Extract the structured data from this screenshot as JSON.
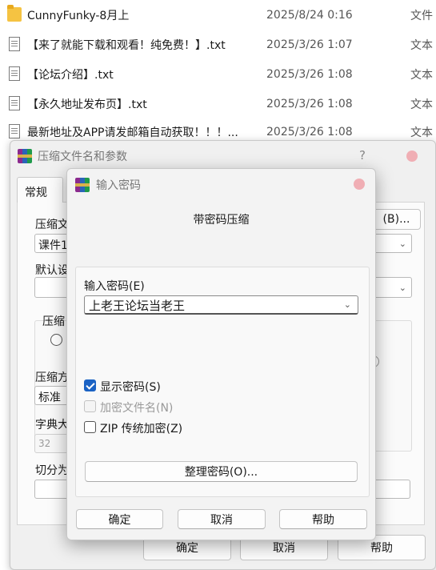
{
  "files": [
    {
      "name": "CunnyFunky-8月上",
      "date": "2025/8/24 0:16",
      "type": "文件",
      "icon": "folder-icon"
    },
    {
      "name": "【来了就能下载和观看！纯免费！】.txt",
      "date": "2025/3/26 1:07",
      "type": "文本",
      "icon": "text-file-icon"
    },
    {
      "name": "【论坛介绍】.txt",
      "date": "2025/3/26 1:08",
      "type": "文本",
      "icon": "text-file-icon"
    },
    {
      "name": "【永久地址发布页】.txt",
      "date": "2025/3/26 1:08",
      "type": "文本",
      "icon": "text-file-icon"
    },
    {
      "name": "最新地址及APP请发邮箱自动获取！！！...",
      "date": "2025/3/26 1:08",
      "type": "文本",
      "icon": "text-file-icon"
    }
  ],
  "main_dialog": {
    "title": "压缩文件名和参数",
    "help": "?",
    "tab_general": "常规",
    "archive_name_label": "压缩文",
    "archive_name_value": "课件1",
    "browse_button": "(B)...",
    "default_profile_label": "默认设",
    "format_label": "压缩",
    "method_label": "压缩方",
    "method_value": "标准",
    "dict_label": "字典大",
    "dict_value": "32",
    "split_label": "切分为",
    "ok": "确定",
    "cancel": "取消",
    "help_button": "帮助"
  },
  "password_dialog": {
    "title": "输入密码",
    "heading": "带密码压缩",
    "password_label": "输入密码(E)",
    "password_value": "上老王论坛当老王",
    "show_password": "显示密码(S)",
    "show_password_checked": true,
    "encrypt_names": "加密文件名(N)",
    "encrypt_names_checked": false,
    "encrypt_names_enabled": false,
    "zip_legacy": "ZIP 传统加密(Z)",
    "zip_legacy_checked": false,
    "organize_button": "整理密码(O)...",
    "ok": "确定",
    "cancel": "取消",
    "help": "帮助"
  },
  "colors": {
    "accent": "#1a62c4",
    "close_dot": "#f0aeb4"
  }
}
